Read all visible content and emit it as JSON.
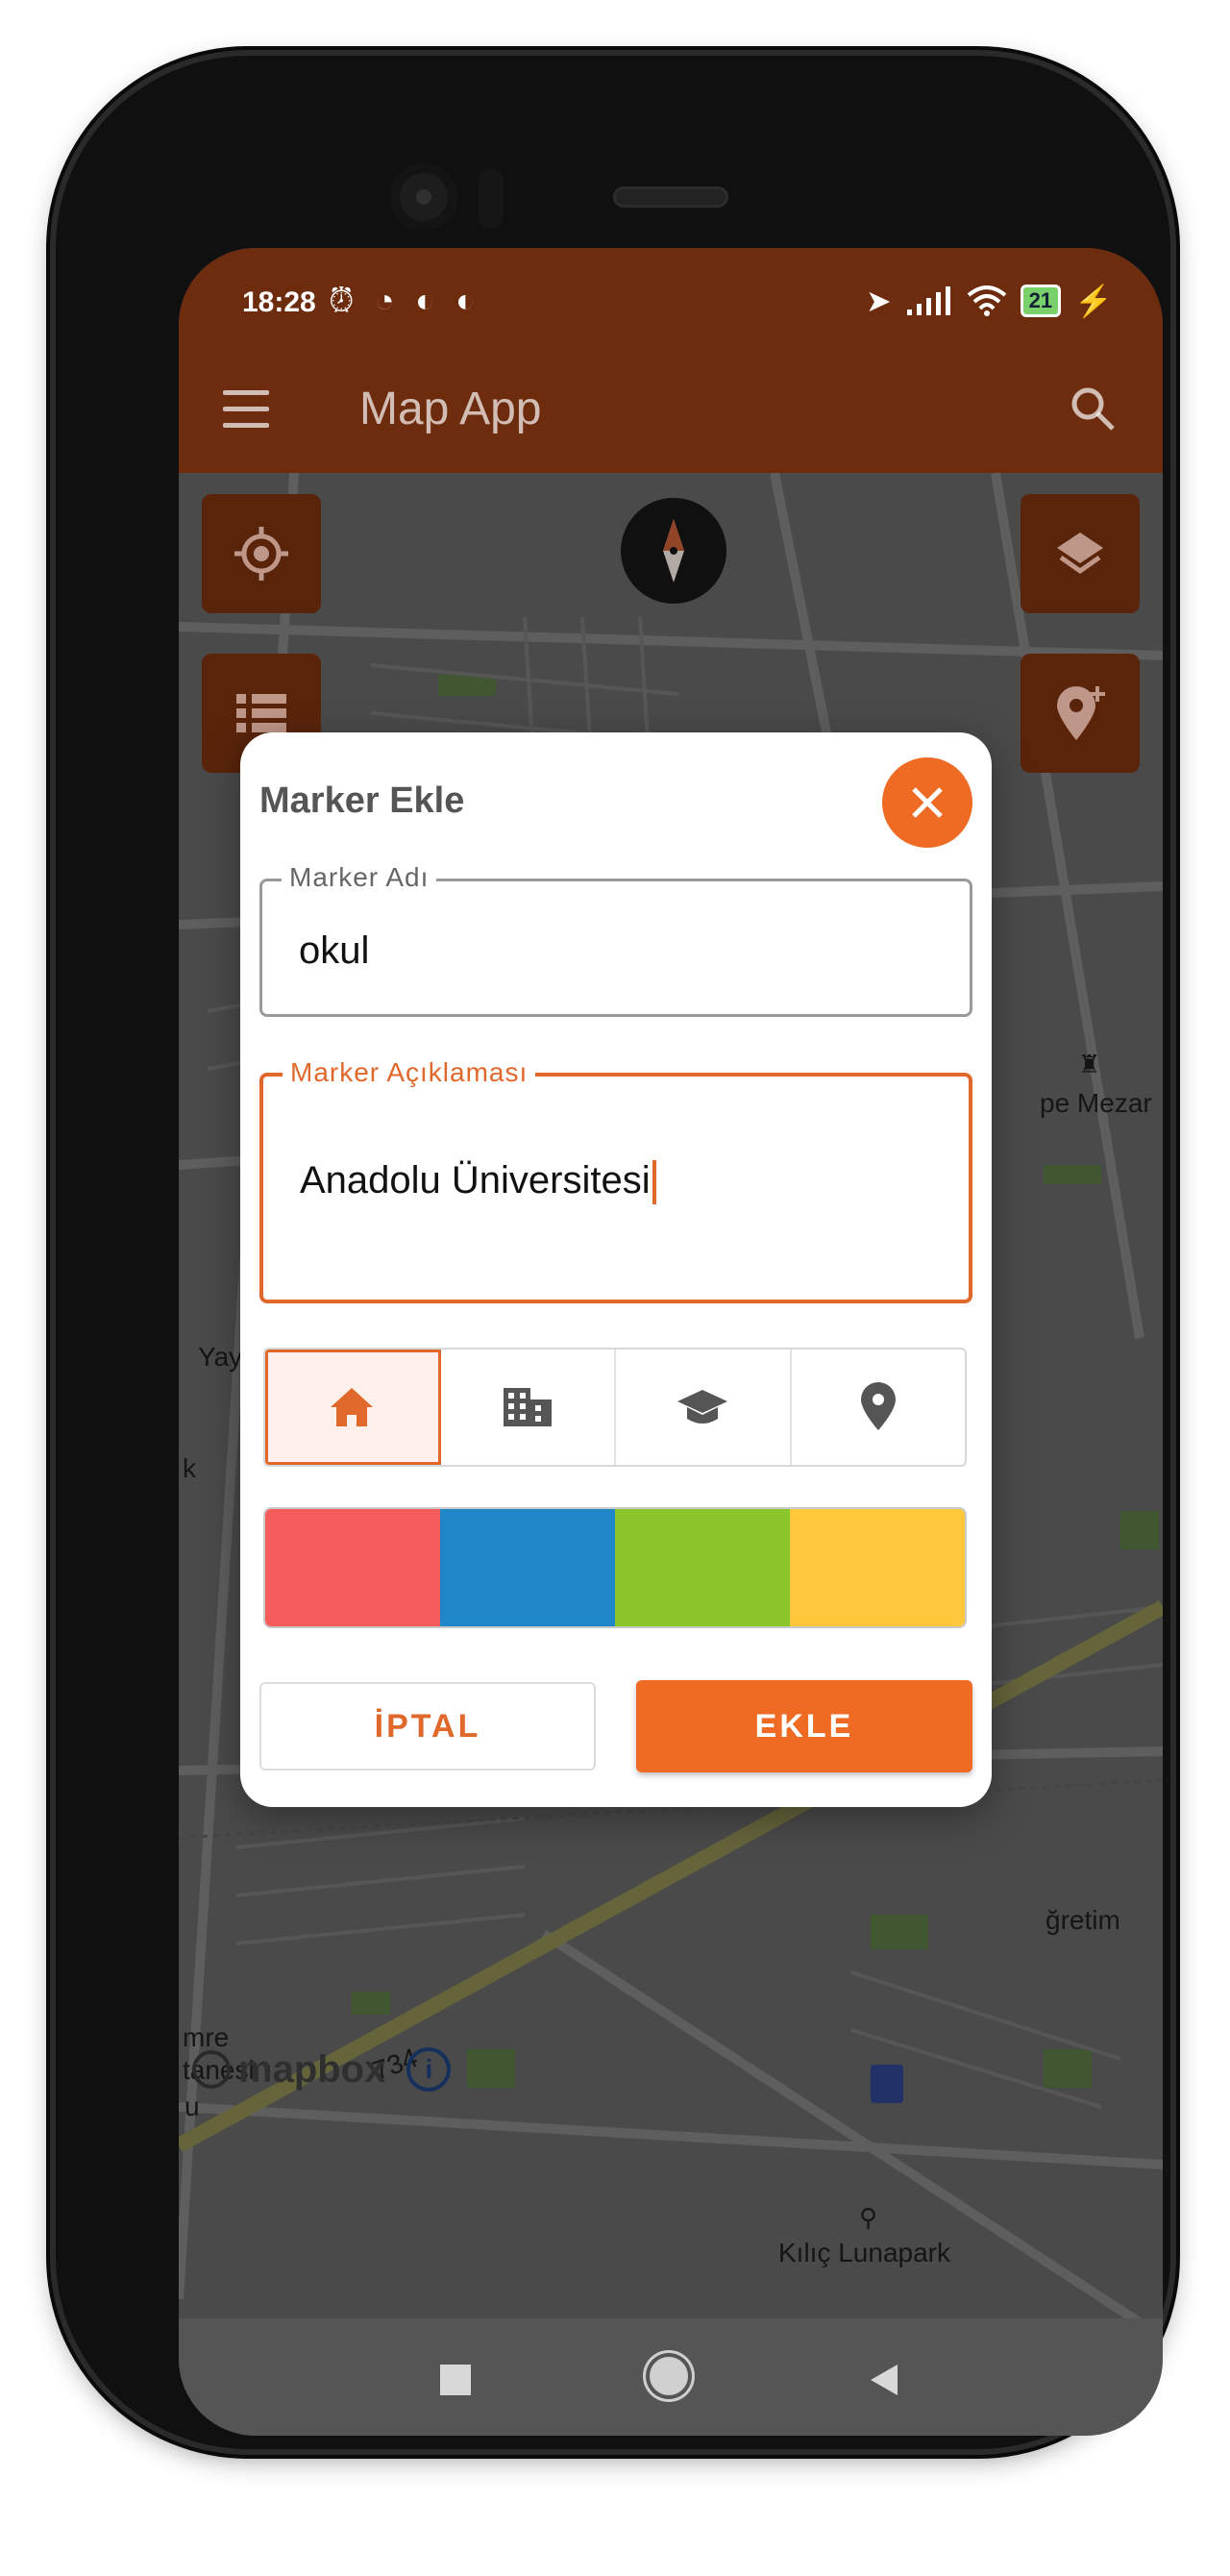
{
  "status_bar": {
    "time": "18:28",
    "left_icons": [
      "alarm-off-icon",
      "alarm-clock-icon",
      "app-notification-icon",
      "app-notification-icon"
    ],
    "right_icons": [
      "location-arrow-icon",
      "cell-signal-icon",
      "wifi-icon"
    ],
    "battery": "21"
  },
  "app_bar": {
    "title": "Map App"
  },
  "map": {
    "labels": {
      "yaylapinar": "Yaylapır",
      "edge_k": "k",
      "mezar": "pe Mezar",
      "ogretim": "ğretim",
      "emre": "mre",
      "hastanesi": "tanesi",
      "u": "u",
      "road_734": "734",
      "lunapark": "Kılıç Lunapark"
    },
    "attribution": "mapbox",
    "attribution_info": "i"
  },
  "dialog": {
    "title": "Marker Ekle",
    "name_field": {
      "label": "Marker Adı",
      "value": "okul"
    },
    "description_field": {
      "label": "Marker Açıklaması",
      "value": "Anadolu Üniversitesi"
    },
    "icon_options": [
      "home-icon",
      "building-icon",
      "graduation-cap-icon",
      "map-pin-icon"
    ],
    "selected_icon": "home-icon",
    "color_options": [
      "#F45B5B",
      "#1F86C8",
      "#8BC72A",
      "#FFC83A"
    ],
    "cancel_label": "İPTAL",
    "add_label": "EKLE"
  },
  "colors": {
    "app_bar": "#6E2C0E",
    "accent": "#EF6A22"
  }
}
